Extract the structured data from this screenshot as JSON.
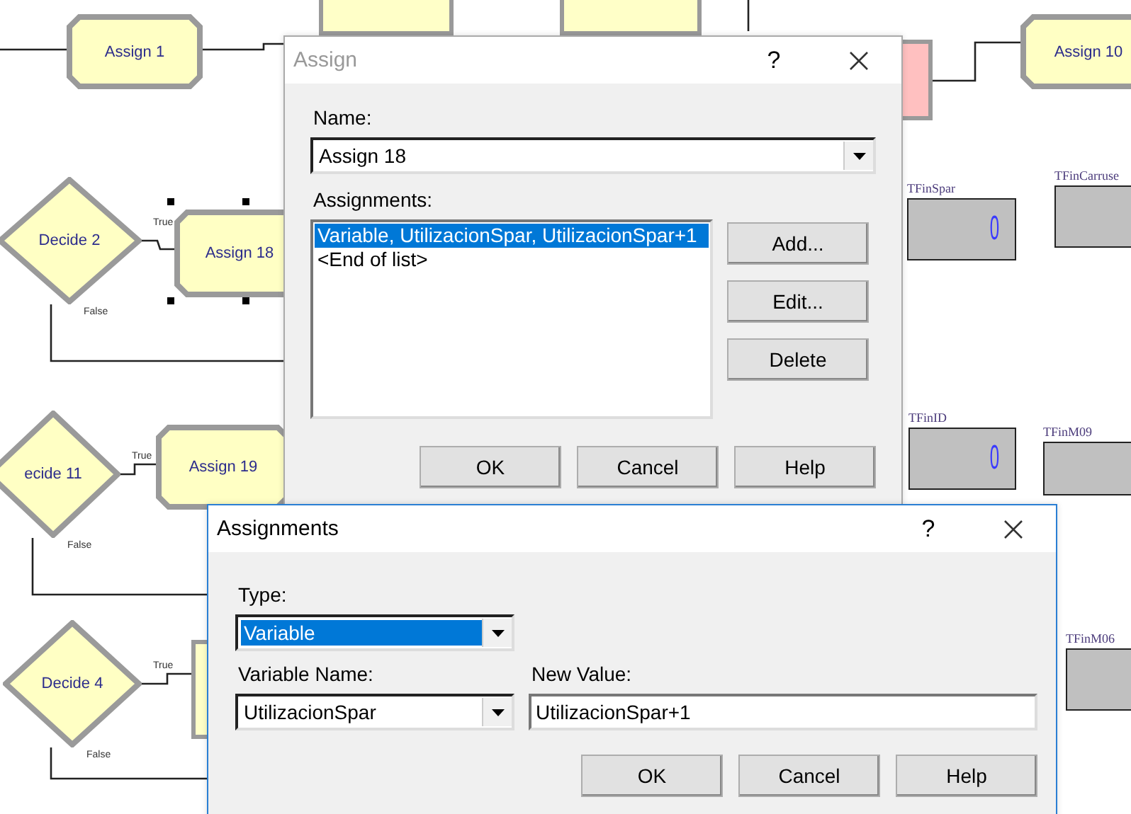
{
  "canvas": {
    "modules": [
      {
        "kind": "assign",
        "label": "Assign 1",
        "selected": false
      },
      {
        "kind": "assign",
        "label": "Assign 10",
        "selected": false
      },
      {
        "kind": "decide",
        "label": "Decide 2",
        "true_label": "True",
        "false_label": "False",
        "selected": false
      },
      {
        "kind": "assign",
        "label": "Assign 18",
        "selected": true
      },
      {
        "kind": "decide",
        "label": "ecide 11",
        "true_label": "True",
        "false_label": "False",
        "selected": false
      },
      {
        "kind": "assign",
        "label": "Assign 19",
        "selected": false
      },
      {
        "kind": "decide",
        "label": "Decide 4",
        "true_label": "True",
        "false_label": "False",
        "selected": false
      }
    ],
    "variables": [
      {
        "name": "TFinSpar",
        "value": "0"
      },
      {
        "name": "TFinCarruse"
      },
      {
        "name": "TFinID",
        "value": "0"
      },
      {
        "name": "TFinM09"
      },
      {
        "name": "TFinM06"
      }
    ]
  },
  "assign_dialog": {
    "title": "Assign",
    "active": false,
    "help": "?",
    "name_label": "Name:",
    "name_value": "Assign 18",
    "assignments_label": "Assignments:",
    "assignments": [
      {
        "text": "Variable, UtilizacionSpar, UtilizacionSpar+1",
        "selected": true
      },
      {
        "text": "<End of list>",
        "selected": false
      }
    ],
    "side_buttons": [
      "Add...",
      "Edit...",
      "Delete"
    ],
    "buttons": [
      "OK",
      "Cancel",
      "Help"
    ]
  },
  "assignments_dialog": {
    "title": "Assignments",
    "active": true,
    "help": "?",
    "type_label": "Type:",
    "type_value": "Variable",
    "type_highlighted": true,
    "variable_name_label": "Variable Name:",
    "variable_name_value": "UtilizacionSpar",
    "new_value_label": "New Value:",
    "new_value": "UtilizacionSpar+1",
    "buttons": [
      "OK",
      "Cancel",
      "Help"
    ]
  }
}
